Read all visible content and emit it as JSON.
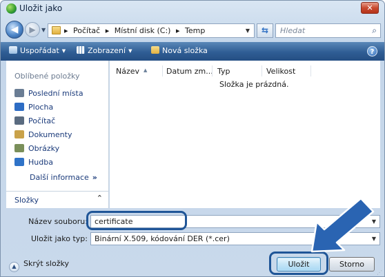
{
  "window": {
    "title": "Uložit jako",
    "close_label": "✕"
  },
  "address": {
    "crumbs": [
      "Počítač",
      "Místní disk (C:)",
      "Temp"
    ],
    "search_placeholder": "Hledat"
  },
  "toolbar": {
    "organize": "Uspořádat",
    "views": "Zobrazení",
    "new_folder": "Nová složka"
  },
  "sidebar": {
    "header": "Oblíbené položky",
    "items": [
      {
        "label": "Poslední místa",
        "icon": "recent-places-icon",
        "color": "#6a7d94"
      },
      {
        "label": "Plocha",
        "icon": "desktop-icon",
        "color": "#2d6cc4"
      },
      {
        "label": "Počítač",
        "icon": "computer-icon",
        "color": "#5a6b80"
      },
      {
        "label": "Dokumenty",
        "icon": "documents-icon",
        "color": "#c9a24a"
      },
      {
        "label": "Obrázky",
        "icon": "pictures-icon",
        "color": "#7a8f5a"
      },
      {
        "label": "Hudba",
        "icon": "music-icon",
        "color": "#2f73c8"
      }
    ],
    "more": "Další informace",
    "more_glyph": "»",
    "folders": "Složky"
  },
  "filelist": {
    "columns": [
      "Název",
      "Datum zm...",
      "Typ",
      "Velikost"
    ],
    "empty_message": "Složka je prázdná."
  },
  "form": {
    "filename_label": "Název souboru:",
    "filename_value": "certificate",
    "filetype_label": "Uložit jako typ:",
    "filetype_value": "Binární X.509, kódování DER (*.cer)",
    "hide_folders": "Skrýt složky",
    "save": "Uložit",
    "cancel": "Storno"
  },
  "colors": {
    "accent": "#1f5597",
    "toolbar": "#2f5d94"
  }
}
